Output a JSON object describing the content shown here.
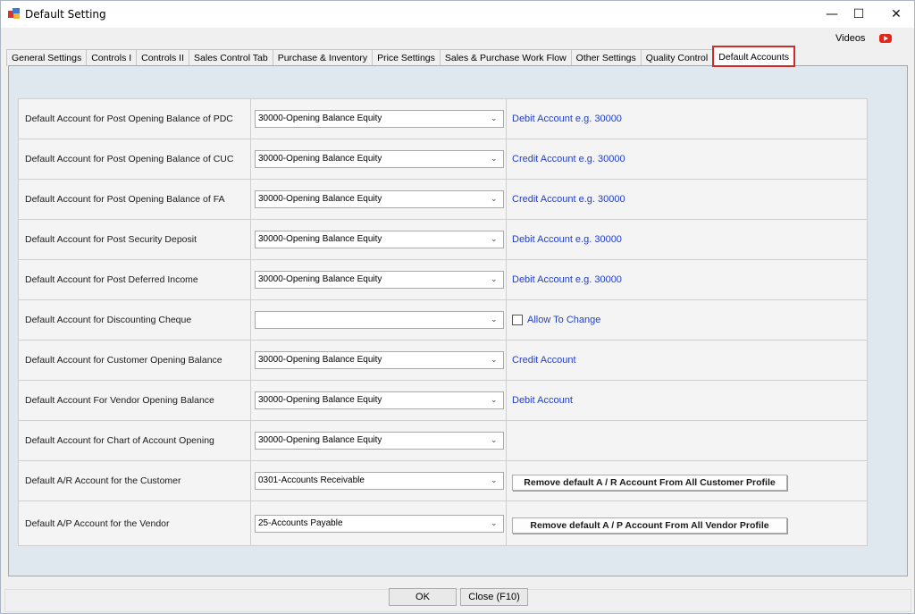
{
  "window": {
    "title": "Default Setting",
    "minimize": "—",
    "maximize": "☐",
    "close": "✕"
  },
  "header": {
    "videos_label": "Videos",
    "video_icon": "youtube-icon"
  },
  "tabs": [
    {
      "label": "General Settings"
    },
    {
      "label": "Controls I"
    },
    {
      "label": "Controls II"
    },
    {
      "label": "Sales Control Tab"
    },
    {
      "label": "Purchase & Inventory"
    },
    {
      "label": "Price Settings"
    },
    {
      "label": "Sales & Purchase Work Flow"
    },
    {
      "label": "Other Settings"
    },
    {
      "label": "Quality Control"
    },
    {
      "label": "Default Accounts"
    }
  ],
  "active_tab": "Default Accounts",
  "rows": [
    {
      "label": "Default Account for Post Opening Balance of PDC",
      "value": "30000-Opening Balance Equity",
      "note": "Debit Account e.g. 30000"
    },
    {
      "label": "Default Account for Post Opening Balance of CUC",
      "value": "30000-Opening Balance Equity",
      "note": "Credit Account e.g. 30000"
    },
    {
      "label": "Default Account for Post Opening Balance of FA",
      "value": "30000-Opening Balance Equity",
      "note": "Credit Account e.g. 30000"
    },
    {
      "label": "Default Account for Post Security Deposit",
      "value": "30000-Opening Balance Equity",
      "note": "Debit Account e.g. 30000"
    },
    {
      "label": "Default Account for Post Deferred Income",
      "value": "30000-Opening Balance Equity",
      "note": "Debit Account e.g. 30000"
    },
    {
      "label": "Default Account for Discounting Cheque",
      "value": "",
      "checkbox_label": "Allow To Change"
    },
    {
      "label": "Default Account for Customer Opening Balance",
      "value": "30000-Opening Balance Equity",
      "note": "Credit Account"
    },
    {
      "label": "Default Account For Vendor Opening Balance",
      "value": "30000-Opening Balance Equity",
      "note": "Debit Account"
    },
    {
      "label": "Default Account for Chart of Account Opening",
      "value": "30000-Opening Balance Equity",
      "note": ""
    },
    {
      "label": "Default A/R Account for the Customer",
      "value": "0301-Accounts Receivable",
      "button": "Remove default A / R Account From All Customer Profile"
    },
    {
      "label": "Default A/P Account for the Vendor",
      "value": "25-Accounts Payable",
      "button": "Remove default A / P Account From All Vendor Profile"
    }
  ],
  "footer": {
    "ok_label": "OK",
    "close_label": "Close (F10)"
  },
  "colors": {
    "active_tab_border": "#d02b2b",
    "note_text": "#2340c8",
    "panel_bg": "#dfe8ee"
  }
}
